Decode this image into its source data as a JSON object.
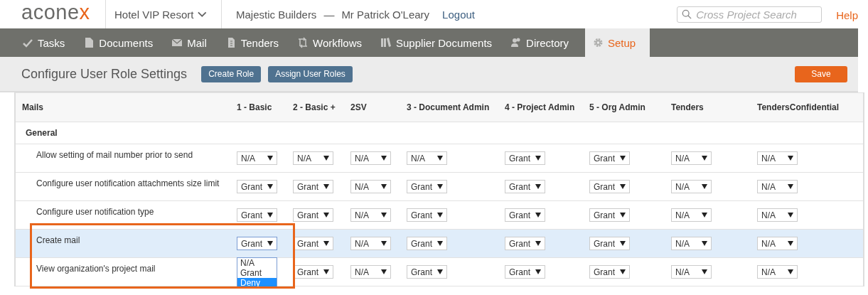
{
  "header": {
    "logo": {
      "text": "acone",
      "accent": "x"
    },
    "project": "Hotel VIP Resort",
    "organization": "Majestic Builders",
    "separator": "—",
    "user": "Mr Patrick O'Leary",
    "logout": "Logout",
    "search": {
      "placeholder": "Cross Project Search"
    },
    "help": "Help"
  },
  "nav": [
    {
      "kind": "tasks",
      "label": "Tasks",
      "selected": false
    },
    {
      "kind": "documents",
      "label": "Documents",
      "selected": false
    },
    {
      "kind": "mail",
      "label": "Mail",
      "selected": false
    },
    {
      "kind": "tenders",
      "label": "Tenders",
      "selected": false
    },
    {
      "kind": "workflows",
      "label": "Workflows",
      "selected": false
    },
    {
      "kind": "supplier",
      "label": "Supplier Documents",
      "selected": false
    },
    {
      "kind": "directory",
      "label": "Directory",
      "selected": false
    },
    {
      "kind": "setup",
      "label": "Setup",
      "selected": true
    }
  ],
  "toolbar": {
    "title": "Configure User Role Settings",
    "buttons": [
      "Create Role",
      "Assign User Roles"
    ],
    "save": "Save"
  },
  "table": {
    "columns": [
      "Mails",
      "1 - Basic",
      "2 - Basic +",
      "2SV",
      "3 - Document Admin",
      "4 - Project Admin",
      "5 - Org Admin",
      "Tenders",
      "TendersConfidential"
    ],
    "group": "General",
    "rows": [
      {
        "label": "Allow setting of mail number prior to send",
        "selected": false,
        "values": [
          "N/A",
          "N/A",
          "N/A",
          "N/A",
          "Grant",
          "Grant",
          "N/A",
          "N/A"
        ]
      },
      {
        "label": "Configure user notification attachments size limit",
        "selected": false,
        "values": [
          "Grant",
          "Grant",
          "N/A",
          "Grant",
          "Grant",
          "Grant",
          "N/A",
          "N/A"
        ]
      },
      {
        "label": "Configure user notification type",
        "selected": false,
        "values": [
          "Grant",
          "Grant",
          "N/A",
          "Grant",
          "Grant",
          "Grant",
          "N/A",
          "N/A"
        ]
      },
      {
        "label": "Create mail",
        "selected": true,
        "values": [
          "Grant",
          "Grant",
          "N/A",
          "Grant",
          "Grant",
          "Grant",
          "N/A",
          "N/A"
        ],
        "open_menu": [
          {
            "label": "N/A",
            "selected": false
          },
          {
            "label": "Grant",
            "selected": false
          },
          {
            "label": "Deny",
            "selected": true
          }
        ]
      },
      {
        "label": "View organization's project mail",
        "selected": false,
        "values": [
          "Grant",
          "N/A",
          "Grant",
          "Grant",
          "Grant",
          "N/A",
          "N/A"
        ]
      }
    ]
  }
}
